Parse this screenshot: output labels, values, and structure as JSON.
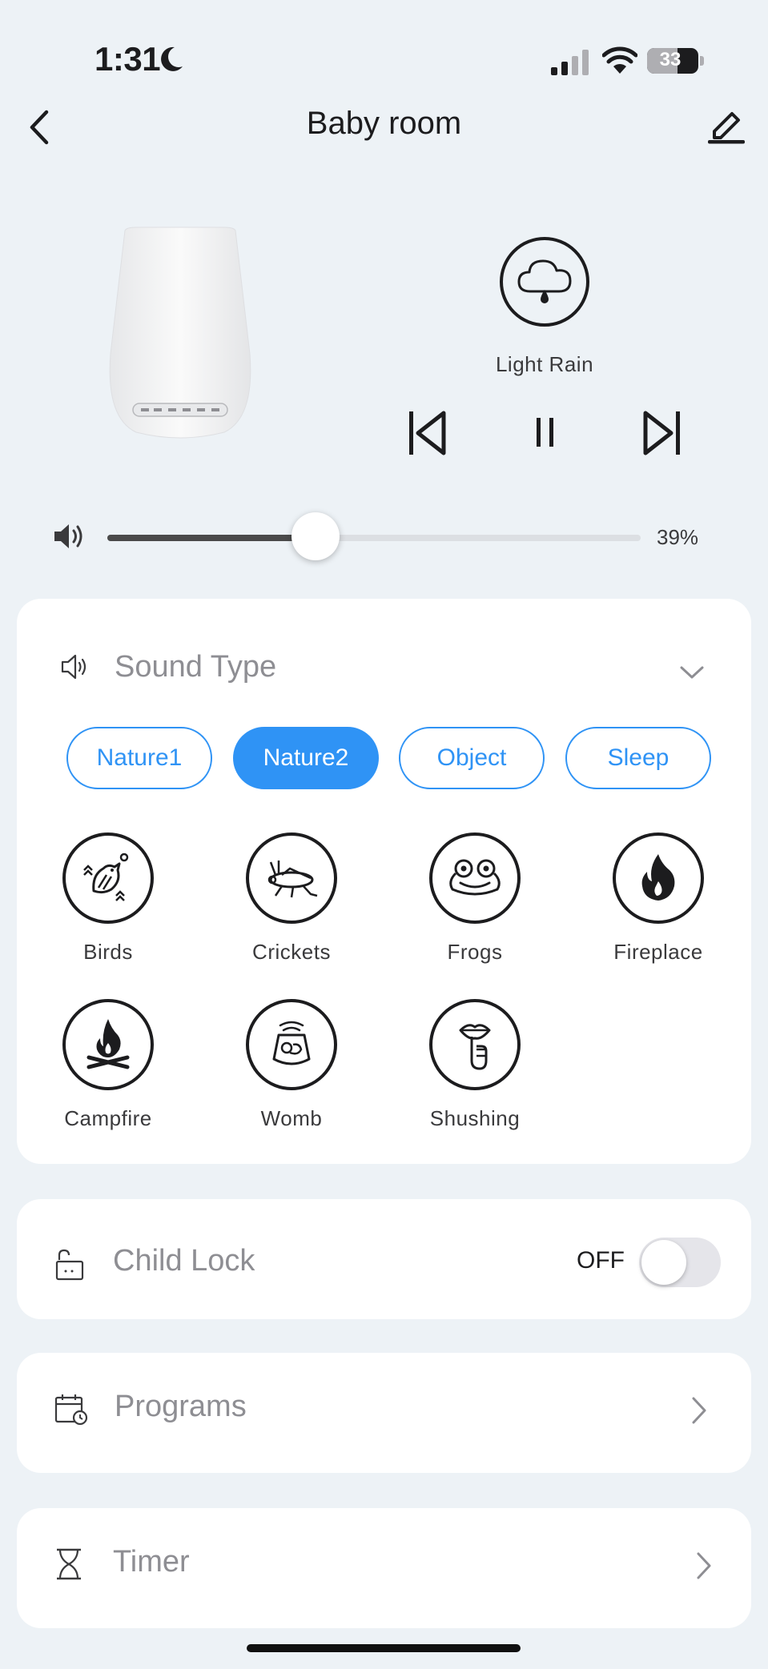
{
  "status_bar": {
    "time": "1:31",
    "battery": "33"
  },
  "header": {
    "title": "Baby room"
  },
  "player": {
    "current_sound": "Light Rain",
    "volume": 39,
    "volume_label": "39%"
  },
  "sound_type": {
    "label": "Sound Type",
    "chips": [
      {
        "label": "Nature1",
        "active": false
      },
      {
        "label": "Nature2",
        "active": true
      },
      {
        "label": "Object",
        "active": false
      },
      {
        "label": "Sleep",
        "active": false
      }
    ],
    "sounds": [
      {
        "label": "Birds",
        "icon": "bird-icon"
      },
      {
        "label": "Crickets",
        "icon": "cricket-icon"
      },
      {
        "label": "Frogs",
        "icon": "frog-icon"
      },
      {
        "label": "Fireplace",
        "icon": "flame-icon"
      },
      {
        "label": "Campfire",
        "icon": "campfire-icon"
      },
      {
        "label": "Womb",
        "icon": "womb-icon"
      },
      {
        "label": "Shushing",
        "icon": "shushing-icon"
      }
    ]
  },
  "child_lock": {
    "label": "Child Lock",
    "state": "OFF"
  },
  "programs": {
    "label": "Programs"
  },
  "timer": {
    "label": "Timer"
  },
  "colors": {
    "accent": "#2f93f5",
    "background": "#edf2f6"
  }
}
